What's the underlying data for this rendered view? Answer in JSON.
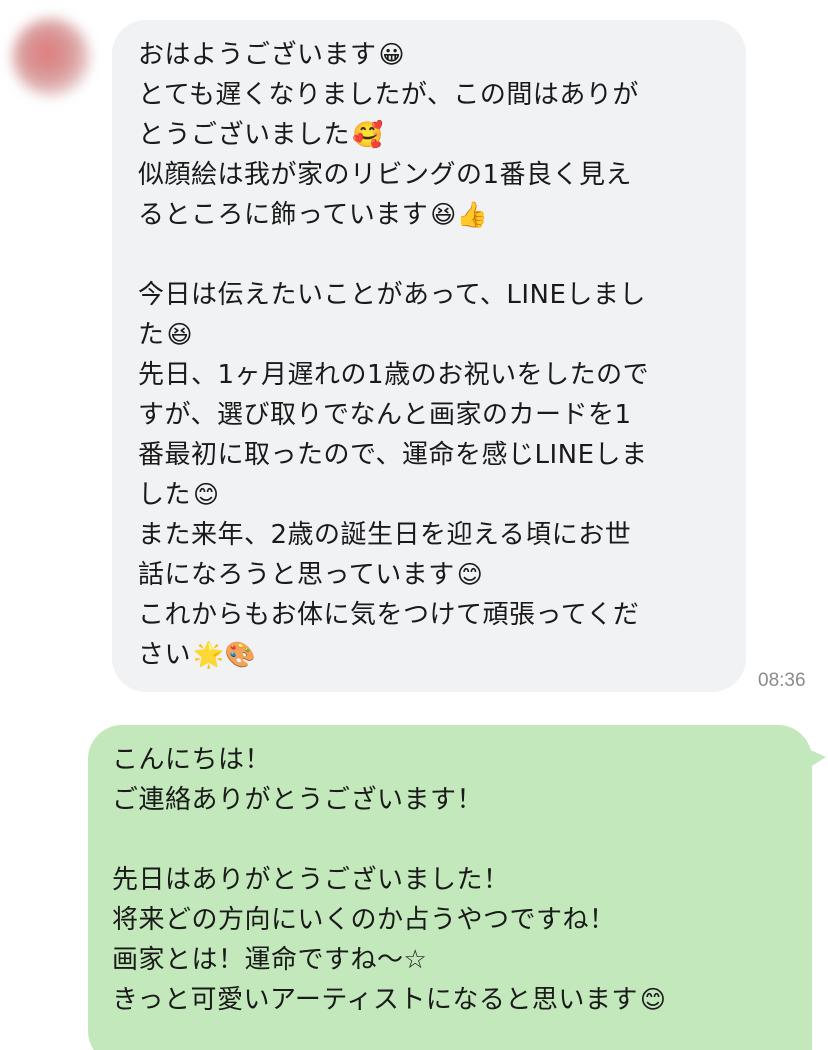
{
  "incoming_message": {
    "lines": [
      {
        "text": "おはようございます",
        "emoji": "😀"
      },
      {
        "text": "とても遅くなりましたが、この間はありが",
        "emoji": ""
      },
      {
        "text": "とうございました",
        "emoji": "🥰"
      },
      {
        "text": "似顔絵は我が家のリビングの1番良く見え",
        "emoji": ""
      },
      {
        "text": "るところに飾っています",
        "emoji": "😆👍"
      },
      {
        "text": "",
        "emoji": ""
      },
      {
        "text": "今日は伝えたいことがあって、LINEしまし",
        "emoji": ""
      },
      {
        "text": "た",
        "emoji": "😆"
      },
      {
        "text": "先日、1ヶ月遅れの1歳のお祝いをしたので",
        "emoji": ""
      },
      {
        "text": "すが、選び取りでなんと画家のカードを1",
        "emoji": ""
      },
      {
        "text": "番最初に取ったので、運命を感じLINEしま",
        "emoji": ""
      },
      {
        "text": "した",
        "emoji": "😊"
      },
      {
        "text": "また来年、2歳の誕生日を迎える頃にお世",
        "emoji": ""
      },
      {
        "text": "話になろうと思っています",
        "emoji": "😊"
      },
      {
        "text": "これからもお体に気をつけて頑張ってくだ",
        "emoji": ""
      },
      {
        "text": "さい",
        "emoji": "🌟🎨"
      }
    ],
    "time": "08:36"
  },
  "outgoing_message": {
    "lines": [
      {
        "text": "こんにちは！",
        "emoji": ""
      },
      {
        "text": "ご連絡ありがとうございます！",
        "emoji": ""
      },
      {
        "text": "",
        "emoji": ""
      },
      {
        "text": "先日はありがとうございました！",
        "emoji": ""
      },
      {
        "text": "将来どの方向にいくのか占うやつですね！",
        "emoji": ""
      },
      {
        "text": "画家とは！運命ですね〜☆",
        "emoji": ""
      },
      {
        "text": "きっと可愛いアーティストになると思います",
        "emoji": "😊"
      }
    ]
  },
  "colors": {
    "incoming_bubble": "#f1f2f4",
    "outgoing_bubble": "#c3e8bb",
    "timestamp": "#8a8a8a"
  }
}
